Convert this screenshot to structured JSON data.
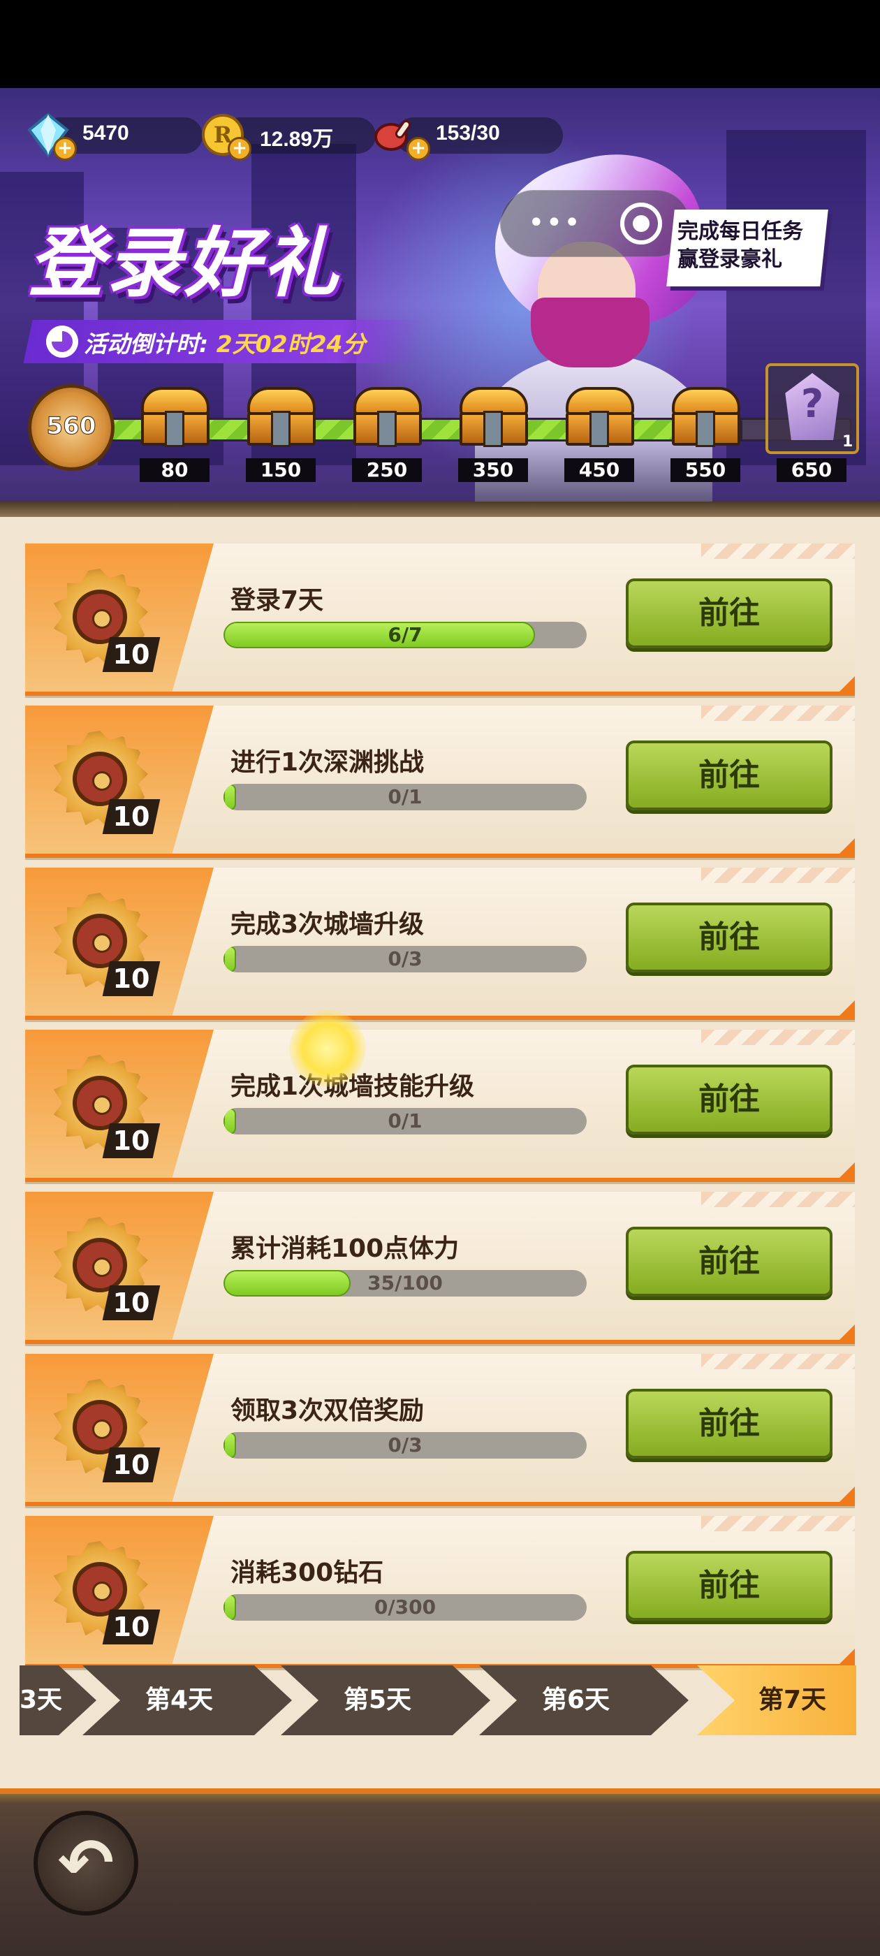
{
  "resources": {
    "diamonds": "5470",
    "coins": "12.89万",
    "stamina": "153/30"
  },
  "event": {
    "title": "登录好礼",
    "countdown_label": "活动倒计时:",
    "countdown_value": "2天02时24分",
    "callout_line1": "完成每日任务",
    "callout_line2": "赢登录豪礼"
  },
  "milestones": {
    "current_score": "560",
    "progress_fraction": 0.86,
    "rewards": [
      "80",
      "150",
      "250",
      "350",
      "450",
      "550",
      "650"
    ],
    "final_reward_count": "1",
    "final_reward_mark": "?"
  },
  "tasks": [
    {
      "title": "登录7天",
      "progress": "6/7",
      "fraction": 0.857,
      "reward": "10",
      "button": "前往"
    },
    {
      "title": "进行1次深渊挑战",
      "progress": "0/1",
      "fraction": 0,
      "reward": "10",
      "button": "前往"
    },
    {
      "title": "完成3次城墙升级",
      "progress": "0/3",
      "fraction": 0,
      "reward": "10",
      "button": "前往"
    },
    {
      "title": "完成1次城墙技能升级",
      "progress": "0/1",
      "fraction": 0,
      "reward": "10",
      "button": "前往"
    },
    {
      "title": "累计消耗100点体力",
      "progress": "35/100",
      "fraction": 0.35,
      "reward": "10",
      "button": "前往"
    },
    {
      "title": "领取3次双倍奖励",
      "progress": "0/3",
      "fraction": 0,
      "reward": "10",
      "button": "前往"
    },
    {
      "title": "消耗300钻石",
      "progress": "0/300",
      "fraction": 0,
      "reward": "10",
      "button": "前往"
    }
  ],
  "day_tabs": [
    {
      "label": "3天",
      "active": false
    },
    {
      "label": "第4天",
      "active": false
    },
    {
      "label": "第5天",
      "active": false
    },
    {
      "label": "第6天",
      "active": false
    },
    {
      "label": "第7天",
      "active": true
    }
  ],
  "wechat_capsule": {
    "more": "•••"
  },
  "back_icon": "back-arrow-icon"
}
